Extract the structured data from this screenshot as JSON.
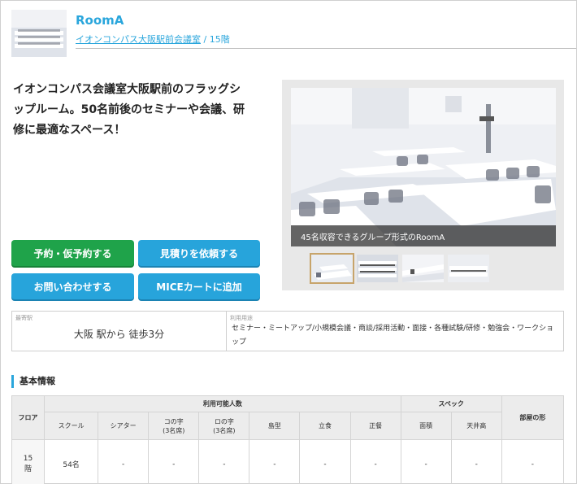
{
  "header": {
    "room_name": "RoomA",
    "venue_link": "イオンコンパス大阪駅前会議室",
    "separator": "/",
    "floor": "15階"
  },
  "catch_copy": {
    "line1": "イオンコンパス会議室大阪駅前のフラッグシ",
    "line2": "ップルーム。50名前後のセミナーや会議、研",
    "line3": "修に最適なスペース！"
  },
  "buttons": {
    "reserve": "予約・仮予約する",
    "estimate": "見積りを依頼する",
    "inquiry": "お問い合わせする",
    "mice_cart": "MICEカートに追加"
  },
  "gallery": {
    "caption": "45名収容できるグループ形式のRoomA",
    "thumb_count": 4
  },
  "info": {
    "station_label": "最寄駅",
    "station_value": "大阪 駅から 徒歩3分",
    "usage_label": "利用用途",
    "usage_value": "セミナー・ミートアップ/小規模会議・商談/採用活動・面接・各種試験/研修・勉強会・ワークショップ"
  },
  "basic_info": {
    "title": "基本情報",
    "table": {
      "col_floor": "フロア",
      "group_capacity": "利用可能人数",
      "group_spec": "スペック",
      "col_shape": "部屋の形",
      "sub_headers": [
        "スクール",
        "シアター",
        "コの字\n(3名席)",
        "ロの字\n(3名席)",
        "島型",
        "立食",
        "正餐",
        "面積",
        "天井高"
      ],
      "rows": [
        {
          "floor": "15\n階",
          "values": [
            "54名",
            "-",
            "-",
            "-",
            "-",
            "-",
            "-",
            "-",
            "-"
          ],
          "shape": "-"
        }
      ]
    }
  },
  "colors": {
    "accent_blue": "#2aa6dc",
    "button_green": "#1fa34a",
    "button_blue": "#27a4db",
    "thumb_active_border": "#c7a46b"
  }
}
